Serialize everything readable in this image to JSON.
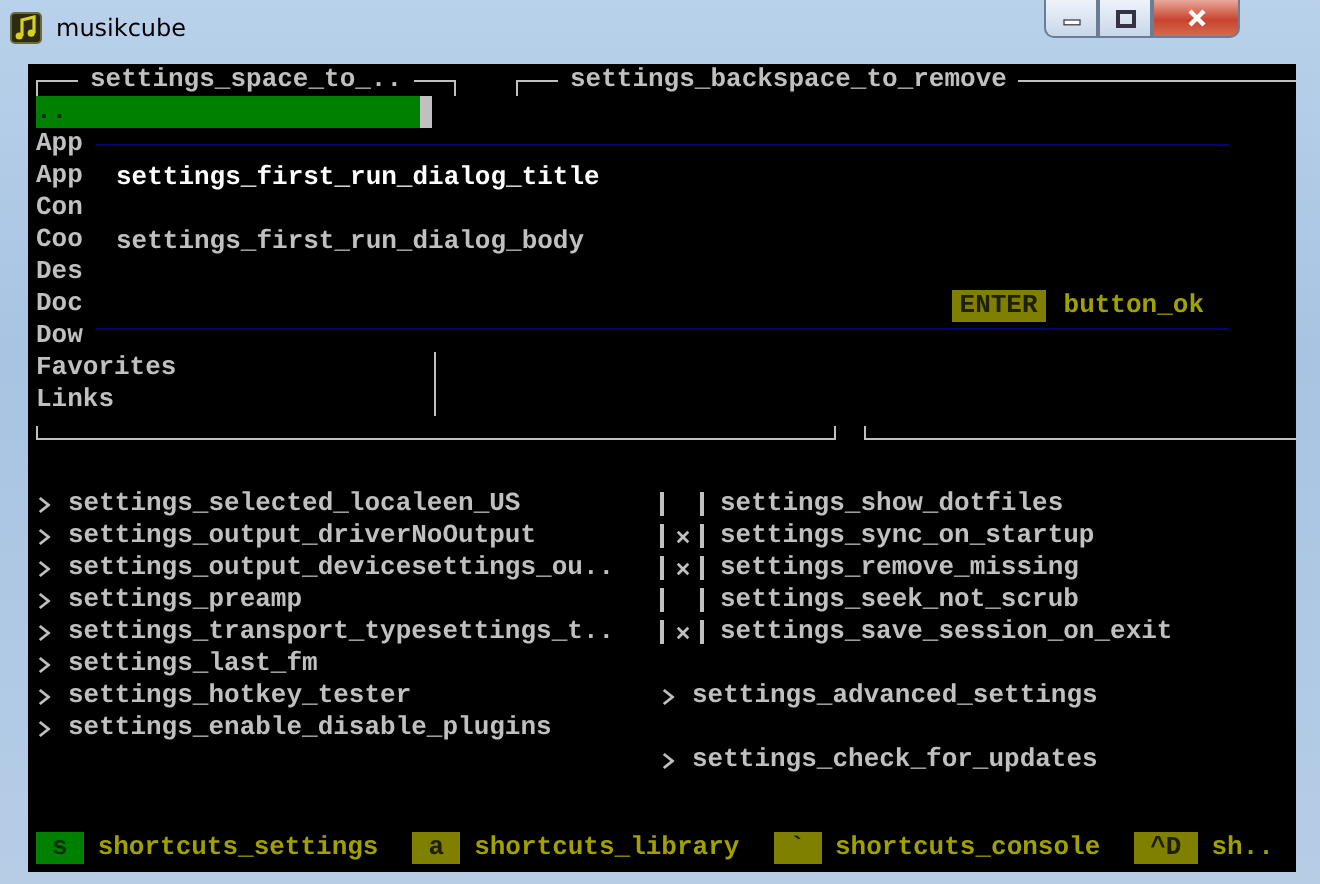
{
  "window": {
    "title": "musikcube"
  },
  "browse": {
    "title": "settings_space_to_..",
    "items": [
      {
        "label": "..",
        "selected": true
      },
      {
        "label": "App",
        "selected": false
      },
      {
        "label": "App",
        "selected": false
      },
      {
        "label": "Con",
        "selected": false
      },
      {
        "label": "Coo",
        "selected": false
      },
      {
        "label": "Des",
        "selected": false
      },
      {
        "label": "Doc",
        "selected": false
      },
      {
        "label": "Dow",
        "selected": false
      },
      {
        "label": "Favorites",
        "selected": false
      },
      {
        "label": "Links",
        "selected": false
      }
    ]
  },
  "ignored": {
    "title": "settings_backspace_to_remove"
  },
  "dialog": {
    "title": "settings_first_run_dialog_title",
    "body": "settings_first_run_dialog_body",
    "key": "ENTER",
    "button": "button_ok"
  },
  "settings_left": [
    {
      "label": "settings_selected_localeen_US"
    },
    {
      "label": "settings_output_driverNoOutput"
    },
    {
      "label": "settings_output_devicesettings_ou.."
    },
    {
      "label": "settings_preamp"
    },
    {
      "label": "settings_transport_typesettings_t.."
    },
    {
      "label": "settings_last_fm"
    },
    {
      "label": "settings_hotkey_tester"
    },
    {
      "label": "settings_enable_disable_plugins"
    }
  ],
  "settings_right": [
    {
      "kind": "checkbox",
      "label": "settings_show_dotfiles",
      "checked": false
    },
    {
      "kind": "checkbox",
      "label": "settings_sync_on_startup",
      "checked": true
    },
    {
      "kind": "checkbox",
      "label": "settings_remove_missing",
      "checked": true
    },
    {
      "kind": "checkbox",
      "label": "settings_seek_not_scrub",
      "checked": false
    },
    {
      "kind": "checkbox",
      "label": "settings_save_session_on_exit",
      "checked": true
    },
    {
      "kind": "action",
      "label": "settings_advanced_settings"
    },
    {
      "kind": "action",
      "label": "settings_check_for_updates"
    }
  ],
  "shortcuts": [
    {
      "key": "s",
      "label": "shortcuts_settings",
      "selected": true
    },
    {
      "key": "a",
      "label": "shortcuts_library",
      "selected": false
    },
    {
      "key": "`",
      "label": "shortcuts_console",
      "selected": false
    },
    {
      "key": "^D",
      "label": "sh..",
      "selected": false
    }
  ]
}
